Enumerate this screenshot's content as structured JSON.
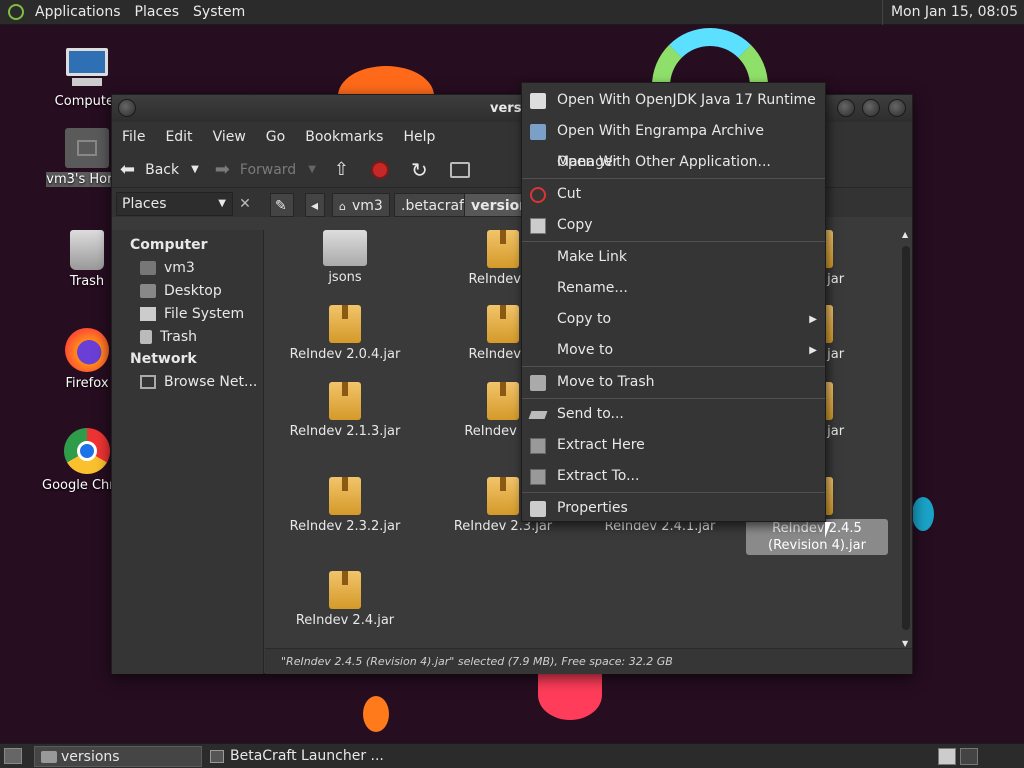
{
  "top_panel": {
    "menus": [
      "Applications",
      "Places",
      "System"
    ],
    "clock": "Mon Jan 15, 08:05"
  },
  "desktop": {
    "icons": [
      {
        "label": "Computer",
        "icon": "computer-icon"
      },
      {
        "label": "vm3's Home",
        "icon": "home-folder-icon"
      },
      {
        "label": "Trash",
        "icon": "trash-icon"
      },
      {
        "label": "Firefox",
        "icon": "firefox-icon"
      },
      {
        "label": "Google Chrome",
        "icon": "chrome-icon"
      }
    ]
  },
  "window": {
    "title": "versions",
    "menubar": [
      "File",
      "Edit",
      "View",
      "Go",
      "Bookmarks",
      "Help"
    ],
    "toolbar": {
      "back": "Back",
      "forward": "Forward"
    },
    "places_combo": "Places",
    "breadcrumbs": [
      "vm3",
      ".betacraft",
      "versions"
    ],
    "sidebar": {
      "computer_heading": "Computer",
      "computer_items": [
        "vm3",
        "Desktop",
        "File System",
        "Trash"
      ],
      "network_heading": "Network",
      "network_items": [
        "Browse Net..."
      ]
    },
    "files": [
      {
        "name": "jsons",
        "type": "folder"
      },
      {
        "name": "ReIndev 2.",
        "type": "jar"
      },
      {
        "name": "2.0.3.jar",
        "type": "jar"
      },
      {
        "name": "ReIndev 2.0.4.jar",
        "type": "jar"
      },
      {
        "name": "ReIndev 2.",
        "type": "jar"
      },
      {
        "name": "2.1.2.jar",
        "type": "jar"
      },
      {
        "name": "ReIndev 2.1.3.jar",
        "type": "jar"
      },
      {
        "name": "ReIndev 2.2",
        "type": "jar"
      },
      {
        "name": "2.3.1.jar",
        "type": "jar"
      },
      {
        "name": "ReIndev 2.3.2.jar",
        "type": "jar"
      },
      {
        "name": "ReIndev 2.3.jar",
        "type": "jar"
      },
      {
        "name": "ReIndev 2.4.1.jar",
        "type": "jar"
      },
      {
        "name": "ReIndev 2.4.5 (Revision 4).jar",
        "type": "jar",
        "selected": true
      },
      {
        "name": "ReIndev 2.4.jar",
        "type": "jar"
      }
    ],
    "status": "\"ReIndev 2.4.5 (Revision 4).jar\" selected (7.9 MB), Free space: 32.2 GB"
  },
  "context_menu": {
    "items": [
      {
        "label": "Open With OpenJDK Java 17 Runtime",
        "icon": "java-icon"
      },
      {
        "label": "Open With Engrampa Archive Manager",
        "icon": "archive-manager-icon"
      },
      {
        "label": "Open With Other Application...",
        "icon": ""
      },
      {
        "label": "Cut",
        "icon": "scissors-icon"
      },
      {
        "label": "Copy",
        "icon": "copy-icon"
      },
      {
        "label": "Make Link",
        "icon": ""
      },
      {
        "label": "Rename...",
        "icon": ""
      },
      {
        "label": "Copy to",
        "icon": "",
        "submenu": true
      },
      {
        "label": "Move to",
        "icon": "",
        "submenu": true
      },
      {
        "label": "Move to Trash",
        "icon": "trash-icon"
      },
      {
        "label": "Send to...",
        "icon": "send-icon"
      },
      {
        "label": "Extract Here",
        "icon": "extract-icon"
      },
      {
        "label": "Extract To...",
        "icon": "extract-icon"
      },
      {
        "label": "Properties",
        "icon": "properties-icon"
      }
    ]
  },
  "bottom_panel": {
    "tasks": [
      "versions",
      "BetaCraft Launcher ..."
    ]
  }
}
